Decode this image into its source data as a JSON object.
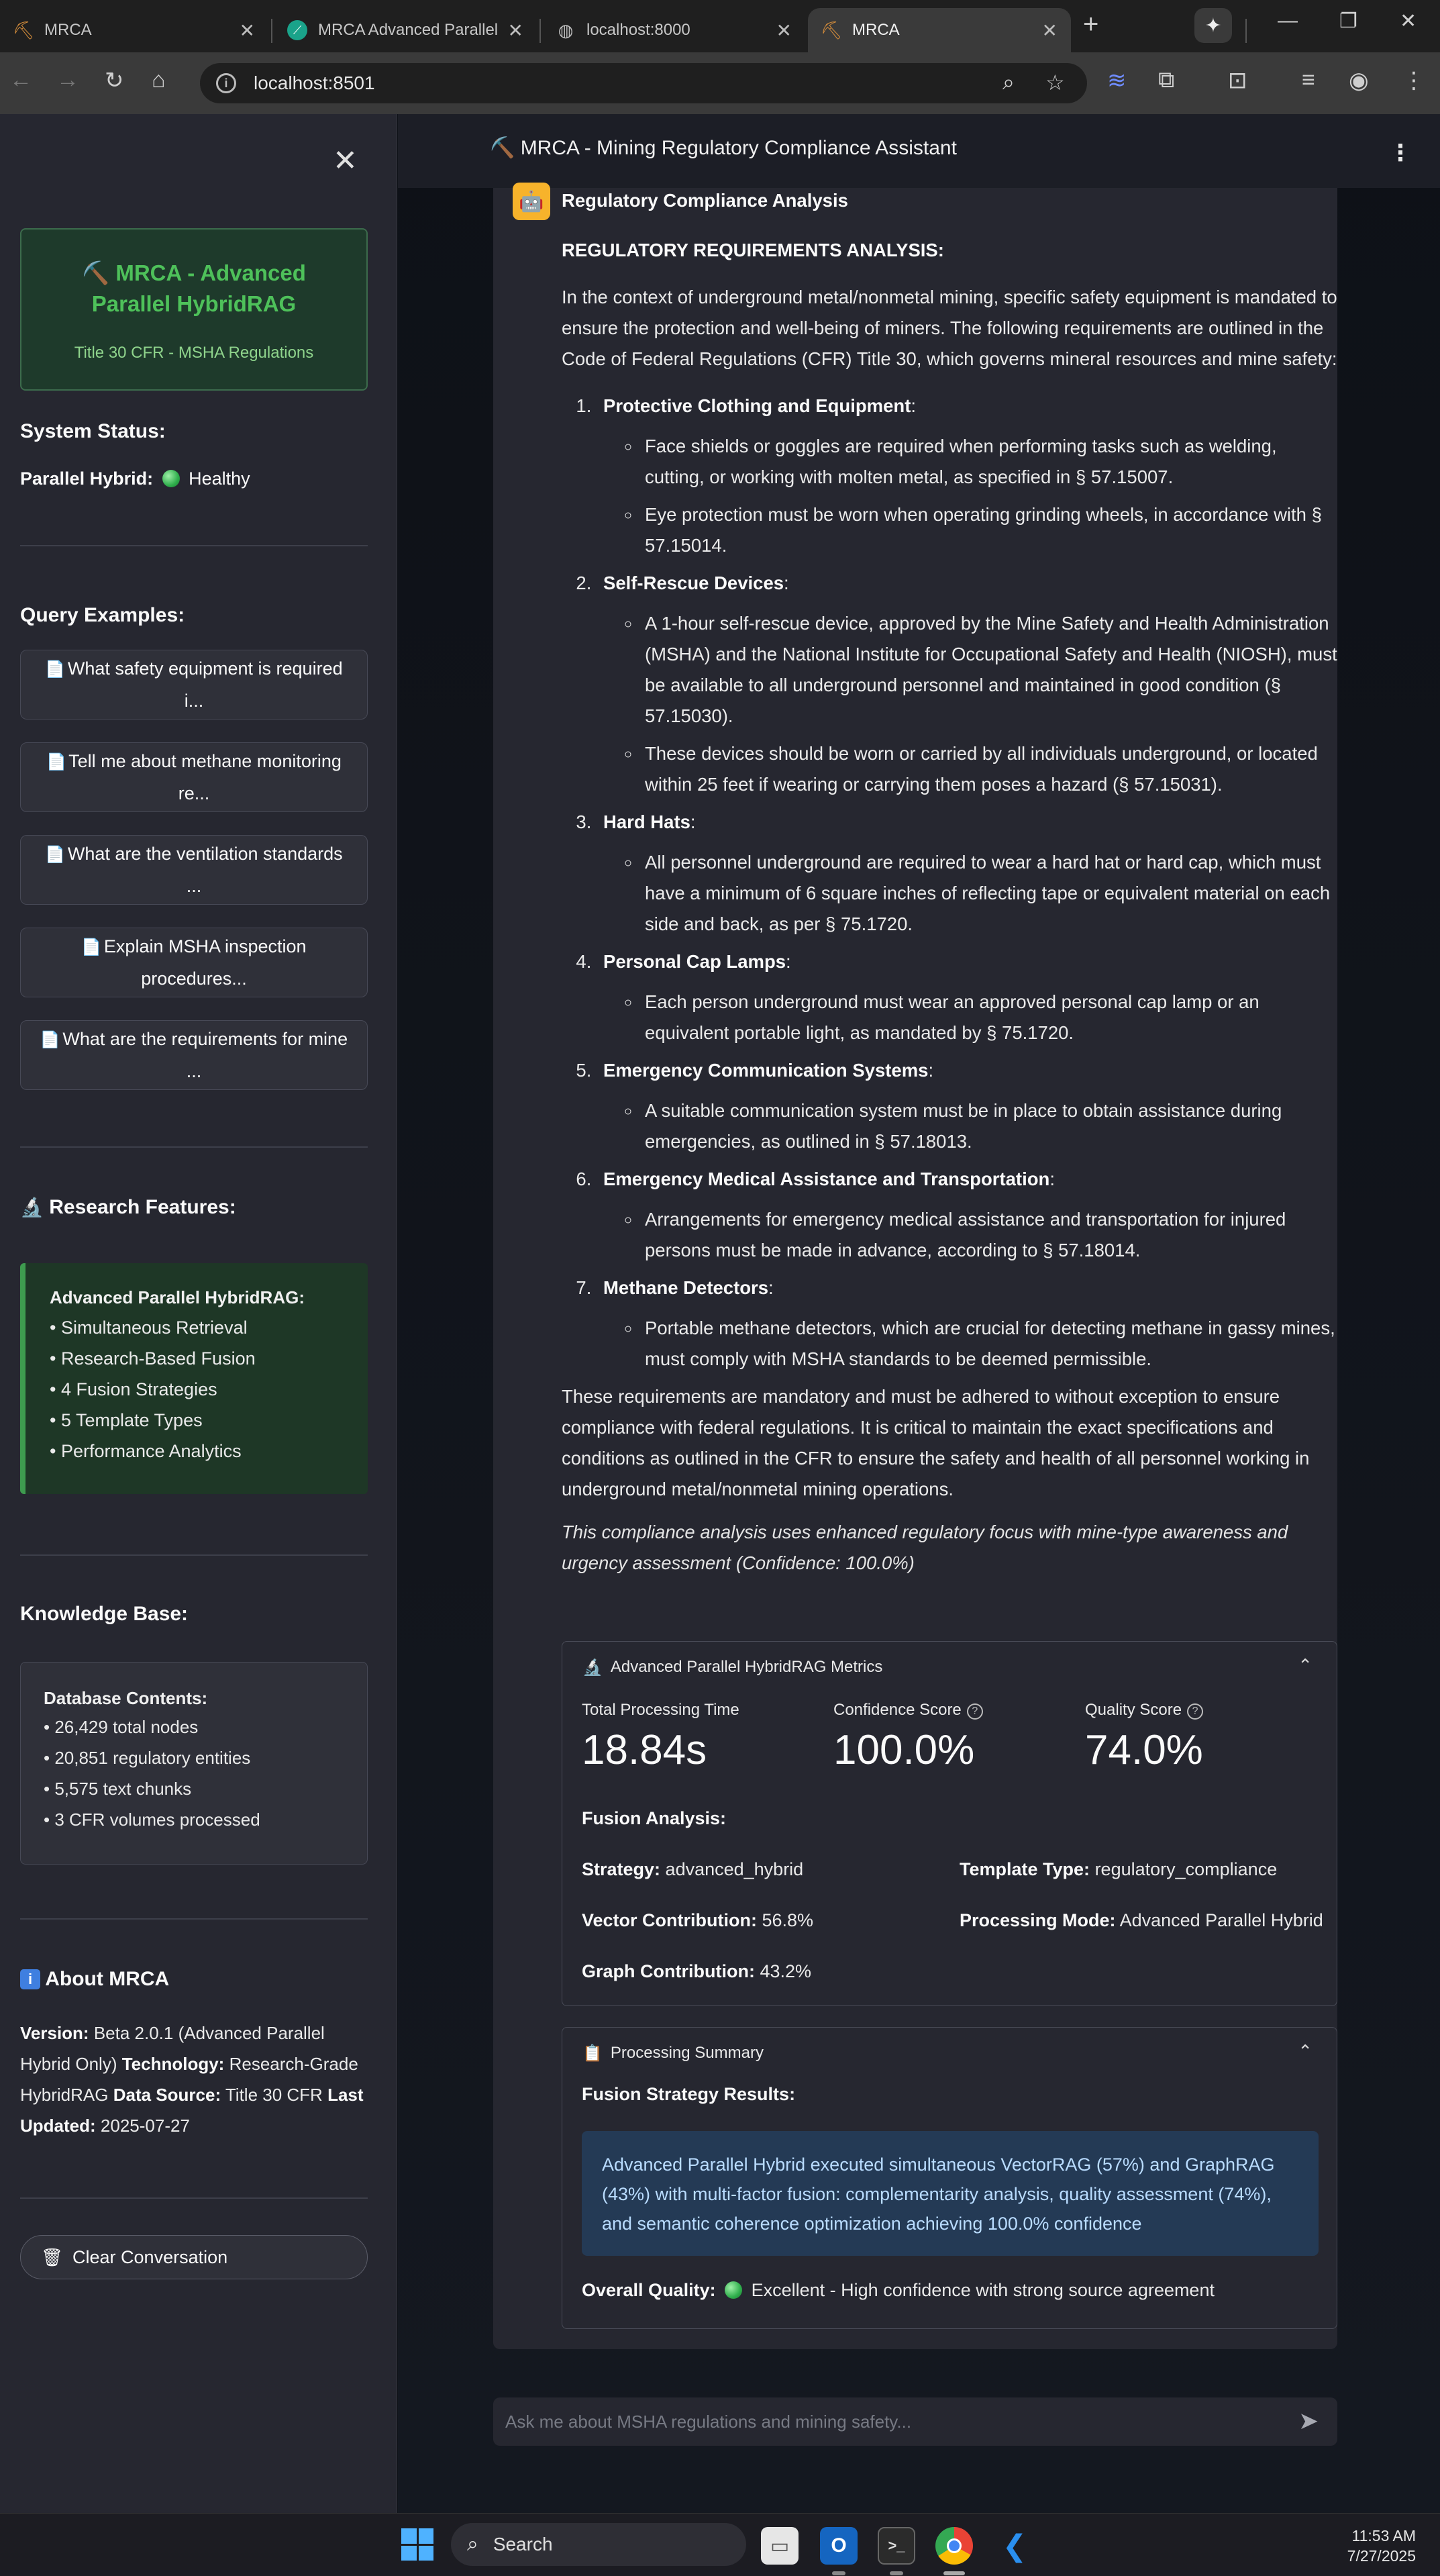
{
  "browser": {
    "tabs": [
      {
        "title": "MRCA",
        "icon": "pickaxe-icon"
      },
      {
        "title": "MRCA Advanced Parallel HybridRAG",
        "icon": "perplexity-icon"
      },
      {
        "title": "localhost:8000",
        "icon": "globe-icon"
      },
      {
        "title": "MRCA",
        "icon": "pickaxe-icon"
      }
    ],
    "url": "localhost:8501"
  },
  "sidebar": {
    "brand_title": "⛏️ MRCA - Advanced Parallel HybridRAG",
    "brand_subtitle": "Title 30 CFR - MSHA Regulations",
    "status_heading": "System Status:",
    "status_label": "Parallel Hybrid:",
    "status_value": "Healthy",
    "examples_heading": "Query Examples:",
    "examples": [
      "What safety equipment is required i...",
      "Tell me about methane monitoring re...",
      "What are the ventilation standards ...",
      "Explain MSHA inspection procedures...",
      "What are the requirements for mine ..."
    ],
    "research_heading": "Research Features:",
    "research_title": "Advanced Parallel HybridRAG:",
    "research_items": [
      "• Simultaneous Retrieval",
      "• Research-Based Fusion",
      "• 4 Fusion Strategies",
      "• 5 Template Types",
      "• Performance Analytics"
    ],
    "kb_heading": "Knowledge Base:",
    "kb_title": "Database Contents:",
    "kb_items": [
      "• 26,429 total nodes",
      "• 20,851 regulatory entities",
      "• 5,575 text chunks",
      "• 3 CFR volumes processed"
    ],
    "about_heading": "About MRCA",
    "about": {
      "version_label": "Version:",
      "version_value": "Beta 2.0.1 (Advanced Parallel Hybrid Only)",
      "tech_label": "Technology:",
      "tech_value": "Research-Grade HybridRAG",
      "source_label": "Data Source:",
      "source_value": "Title 30 CFR",
      "updated_label": "Last Updated:",
      "updated_value": "2025-07-27"
    },
    "clear_button": "Clear Conversation"
  },
  "header": {
    "title": "⛏️ MRCA - Mining Regulatory Compliance Assistant"
  },
  "message": {
    "heading": "Regulatory Compliance Analysis",
    "subheading": "REGULATORY REQUIREMENTS ANALYSIS:",
    "intro": "In the context of underground metal/nonmetal mining, specific safety equipment is mandated to ensure the protection and well-being of miners. The following requirements are outlined in the Code of Federal Regulations (CFR) Title 30, which governs mineral resources and mine safety:",
    "sections": [
      {
        "title": "Protective Clothing and Equipment",
        "bullets": [
          "Face shields or goggles are required when performing tasks such as welding, cutting, or working with molten metal, as specified in § 57.15007.",
          "Eye protection must be worn when operating grinding wheels, in accordance with § 57.15014."
        ]
      },
      {
        "title": "Self-Rescue Devices",
        "bullets": [
          "A 1-hour self-rescue device, approved by the Mine Safety and Health Administration (MSHA) and the National Institute for Occupational Safety and Health (NIOSH), must be available to all underground personnel and maintained in good condition (§ 57.15030).",
          "These devices should be worn or carried by all individuals underground, or located within 25 feet if wearing or carrying them poses a hazard (§ 57.15031)."
        ]
      },
      {
        "title": "Hard Hats",
        "bullets": [
          "All personnel underground are required to wear a hard hat or hard cap, which must have a minimum of 6 square inches of reflecting tape or equivalent material on each side and back, as per § 75.1720."
        ]
      },
      {
        "title": "Personal Cap Lamps",
        "bullets": [
          "Each person underground must wear an approved personal cap lamp or an equivalent portable light, as mandated by § 75.1720."
        ]
      },
      {
        "title": "Emergency Communication Systems",
        "bullets": [
          "A suitable communication system must be in place to obtain assistance during emergencies, as outlined in § 57.18013."
        ]
      },
      {
        "title": "Emergency Medical Assistance and Transportation",
        "bullets": [
          "Arrangements for emergency medical assistance and transportation for injured persons must be made in advance, according to § 57.18014."
        ]
      },
      {
        "title": "Methane Detectors",
        "bullets": [
          "Portable methane detectors, which are crucial for detecting methane in gassy mines, must comply with MSHA standards to be deemed permissible."
        ]
      }
    ],
    "conclusion": "These requirements are mandatory and must be adhered to without exception to ensure compliance with federal regulations. It is critical to maintain the exact specifications and conditions as outlined in the CFR to ensure the safety and health of all personnel working in underground metal/nonmetal mining operations.",
    "note": "This compliance analysis uses enhanced regulatory focus with mine-type awareness and urgency assessment (Confidence: 100.0%)"
  },
  "metrics": {
    "header": "Advanced Parallel HybridRAG Metrics",
    "total_time_label": "Total Processing Time",
    "total_time_value": "18.84s",
    "confidence_label": "Confidence Score",
    "confidence_value": "100.0%",
    "quality_label": "Quality Score",
    "quality_value": "74.0%",
    "fusion_heading": "Fusion Analysis:",
    "strategy_label": "Strategy:",
    "strategy_value": "advanced_hybrid",
    "template_label": "Template Type:",
    "template_value": "regulatory_compliance",
    "vector_label": "Vector Contribution:",
    "vector_value": "56.8%",
    "mode_label": "Processing Mode:",
    "mode_value": "Advanced Parallel Hybrid",
    "graph_label": "Graph Contribution:",
    "graph_value": "43.2%"
  },
  "summary": {
    "header": "Processing Summary",
    "results_heading": "Fusion Strategy Results:",
    "results_text": "Advanced Parallel Hybrid executed simultaneous VectorRAG (57%) and GraphRAG (43%) with multi-factor fusion: complementarity analysis, quality assessment (74%), and semantic coherence optimization achieving 100.0% confidence",
    "quality_label": "Overall Quality:",
    "quality_value": "Excellent - High confidence with strong source agreement"
  },
  "chat_input": {
    "placeholder": "Ask me about MSHA regulations and mining safety..."
  },
  "taskbar": {
    "search_label": "Search",
    "time": "11:53 AM",
    "date": "7/27/2025"
  },
  "colors": {
    "accent_green": "#4ec15a",
    "info_blue": "#243a55",
    "avatar_orange": "#f7b32b"
  }
}
